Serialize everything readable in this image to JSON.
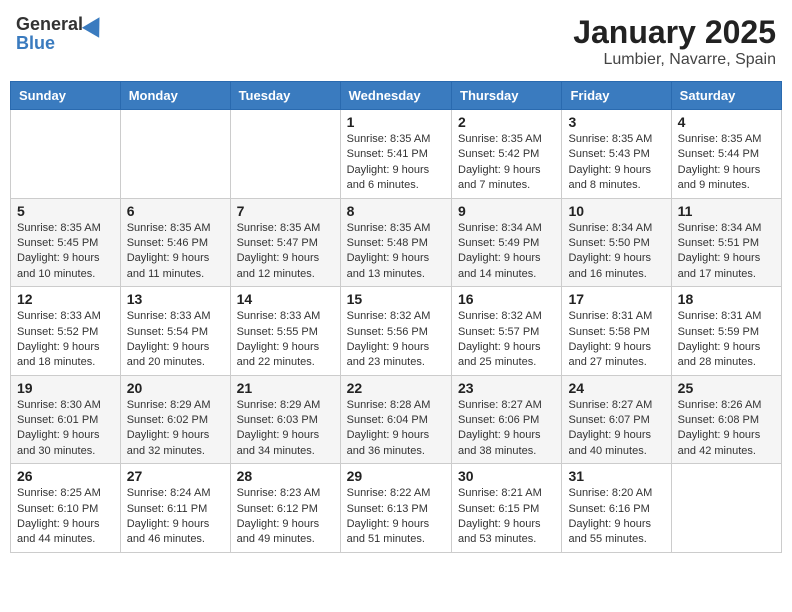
{
  "header": {
    "logo_general": "General",
    "logo_blue": "Blue",
    "month_title": "January 2025",
    "location": "Lumbier, Navarre, Spain"
  },
  "days_of_week": [
    "Sunday",
    "Monday",
    "Tuesday",
    "Wednesday",
    "Thursday",
    "Friday",
    "Saturday"
  ],
  "weeks": [
    [
      {
        "day": "",
        "info": ""
      },
      {
        "day": "",
        "info": ""
      },
      {
        "day": "",
        "info": ""
      },
      {
        "day": "1",
        "info": "Sunrise: 8:35 AM\nSunset: 5:41 PM\nDaylight: 9 hours\nand 6 minutes."
      },
      {
        "day": "2",
        "info": "Sunrise: 8:35 AM\nSunset: 5:42 PM\nDaylight: 9 hours\nand 7 minutes."
      },
      {
        "day": "3",
        "info": "Sunrise: 8:35 AM\nSunset: 5:43 PM\nDaylight: 9 hours\nand 8 minutes."
      },
      {
        "day": "4",
        "info": "Sunrise: 8:35 AM\nSunset: 5:44 PM\nDaylight: 9 hours\nand 9 minutes."
      }
    ],
    [
      {
        "day": "5",
        "info": "Sunrise: 8:35 AM\nSunset: 5:45 PM\nDaylight: 9 hours\nand 10 minutes."
      },
      {
        "day": "6",
        "info": "Sunrise: 8:35 AM\nSunset: 5:46 PM\nDaylight: 9 hours\nand 11 minutes."
      },
      {
        "day": "7",
        "info": "Sunrise: 8:35 AM\nSunset: 5:47 PM\nDaylight: 9 hours\nand 12 minutes."
      },
      {
        "day": "8",
        "info": "Sunrise: 8:35 AM\nSunset: 5:48 PM\nDaylight: 9 hours\nand 13 minutes."
      },
      {
        "day": "9",
        "info": "Sunrise: 8:34 AM\nSunset: 5:49 PM\nDaylight: 9 hours\nand 14 minutes."
      },
      {
        "day": "10",
        "info": "Sunrise: 8:34 AM\nSunset: 5:50 PM\nDaylight: 9 hours\nand 16 minutes."
      },
      {
        "day": "11",
        "info": "Sunrise: 8:34 AM\nSunset: 5:51 PM\nDaylight: 9 hours\nand 17 minutes."
      }
    ],
    [
      {
        "day": "12",
        "info": "Sunrise: 8:33 AM\nSunset: 5:52 PM\nDaylight: 9 hours\nand 18 minutes."
      },
      {
        "day": "13",
        "info": "Sunrise: 8:33 AM\nSunset: 5:54 PM\nDaylight: 9 hours\nand 20 minutes."
      },
      {
        "day": "14",
        "info": "Sunrise: 8:33 AM\nSunset: 5:55 PM\nDaylight: 9 hours\nand 22 minutes."
      },
      {
        "day": "15",
        "info": "Sunrise: 8:32 AM\nSunset: 5:56 PM\nDaylight: 9 hours\nand 23 minutes."
      },
      {
        "day": "16",
        "info": "Sunrise: 8:32 AM\nSunset: 5:57 PM\nDaylight: 9 hours\nand 25 minutes."
      },
      {
        "day": "17",
        "info": "Sunrise: 8:31 AM\nSunset: 5:58 PM\nDaylight: 9 hours\nand 27 minutes."
      },
      {
        "day": "18",
        "info": "Sunrise: 8:31 AM\nSunset: 5:59 PM\nDaylight: 9 hours\nand 28 minutes."
      }
    ],
    [
      {
        "day": "19",
        "info": "Sunrise: 8:30 AM\nSunset: 6:01 PM\nDaylight: 9 hours\nand 30 minutes."
      },
      {
        "day": "20",
        "info": "Sunrise: 8:29 AM\nSunset: 6:02 PM\nDaylight: 9 hours\nand 32 minutes."
      },
      {
        "day": "21",
        "info": "Sunrise: 8:29 AM\nSunset: 6:03 PM\nDaylight: 9 hours\nand 34 minutes."
      },
      {
        "day": "22",
        "info": "Sunrise: 8:28 AM\nSunset: 6:04 PM\nDaylight: 9 hours\nand 36 minutes."
      },
      {
        "day": "23",
        "info": "Sunrise: 8:27 AM\nSunset: 6:06 PM\nDaylight: 9 hours\nand 38 minutes."
      },
      {
        "day": "24",
        "info": "Sunrise: 8:27 AM\nSunset: 6:07 PM\nDaylight: 9 hours\nand 40 minutes."
      },
      {
        "day": "25",
        "info": "Sunrise: 8:26 AM\nSunset: 6:08 PM\nDaylight: 9 hours\nand 42 minutes."
      }
    ],
    [
      {
        "day": "26",
        "info": "Sunrise: 8:25 AM\nSunset: 6:10 PM\nDaylight: 9 hours\nand 44 minutes."
      },
      {
        "day": "27",
        "info": "Sunrise: 8:24 AM\nSunset: 6:11 PM\nDaylight: 9 hours\nand 46 minutes."
      },
      {
        "day": "28",
        "info": "Sunrise: 8:23 AM\nSunset: 6:12 PM\nDaylight: 9 hours\nand 49 minutes."
      },
      {
        "day": "29",
        "info": "Sunrise: 8:22 AM\nSunset: 6:13 PM\nDaylight: 9 hours\nand 51 minutes."
      },
      {
        "day": "30",
        "info": "Sunrise: 8:21 AM\nSunset: 6:15 PM\nDaylight: 9 hours\nand 53 minutes."
      },
      {
        "day": "31",
        "info": "Sunrise: 8:20 AM\nSunset: 6:16 PM\nDaylight: 9 hours\nand 55 minutes."
      },
      {
        "day": "",
        "info": ""
      }
    ]
  ]
}
